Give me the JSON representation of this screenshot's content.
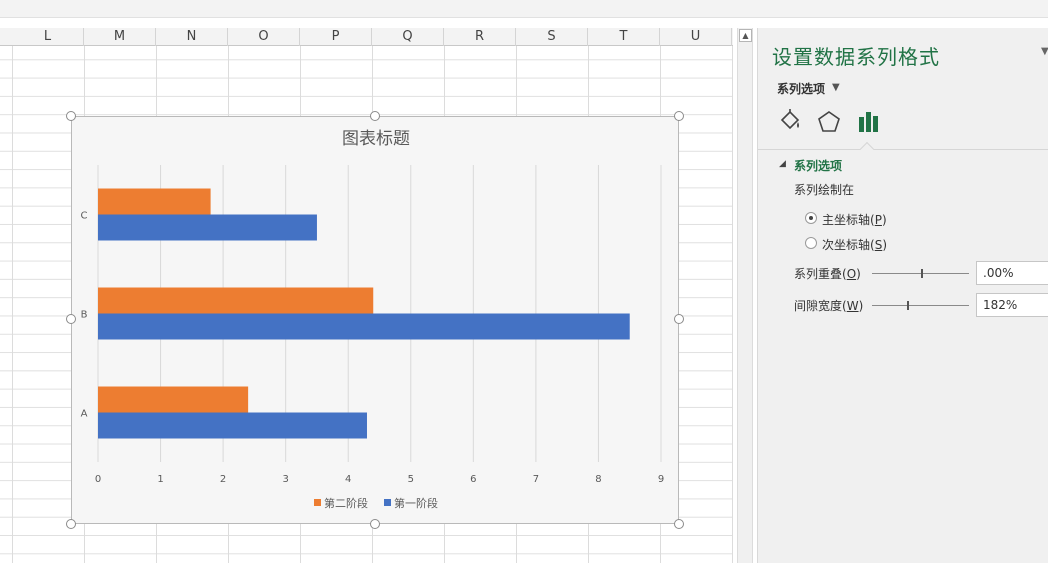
{
  "sheet": {
    "columns": [
      "L",
      "M",
      "N",
      "O",
      "P",
      "Q",
      "R",
      "S",
      "T",
      "U"
    ]
  },
  "chart_data": {
    "type": "bar",
    "orientation": "horizontal",
    "title": "图表标题",
    "categories": [
      "A",
      "B",
      "C"
    ],
    "series": [
      {
        "name": "第一阶段",
        "color": "#4472C4",
        "values": [
          4.3,
          8.5,
          3.5
        ]
      },
      {
        "name": "第二阶段",
        "color": "#ED7D31",
        "values": [
          2.4,
          4.4,
          1.8
        ]
      }
    ],
    "xlim": [
      0,
      9
    ],
    "x_ticks": [
      "0",
      "1",
      "2",
      "3",
      "4",
      "5",
      "6",
      "7",
      "8",
      "9"
    ],
    "grid": "vertical",
    "legend_position": "bottom",
    "legend": [
      "第二阶段",
      "第一阶段"
    ]
  },
  "pane": {
    "title": "设置数据系列格式",
    "subtitle": "系列选项",
    "tabs": [
      "fill-line-icon",
      "effects-pentagon-icon",
      "series-options-chart-icon"
    ],
    "section": "系列选项",
    "plot_on_label": "系列绘制在",
    "radio_primary": {
      "text": "主坐标轴(",
      "key": "P",
      "close": ")",
      "checked": true
    },
    "radio_secondary": {
      "text": "次坐标轴(",
      "key": "S",
      "close": ")",
      "checked": false
    },
    "overlap": {
      "text": "系列重叠(",
      "key": "O",
      "close": ")",
      "value": ".00%",
      "level": 0.5
    },
    "gap": {
      "text": "间隙宽度(",
      "key": "W",
      "close": ")",
      "value": "182%",
      "level": 0.36
    }
  }
}
